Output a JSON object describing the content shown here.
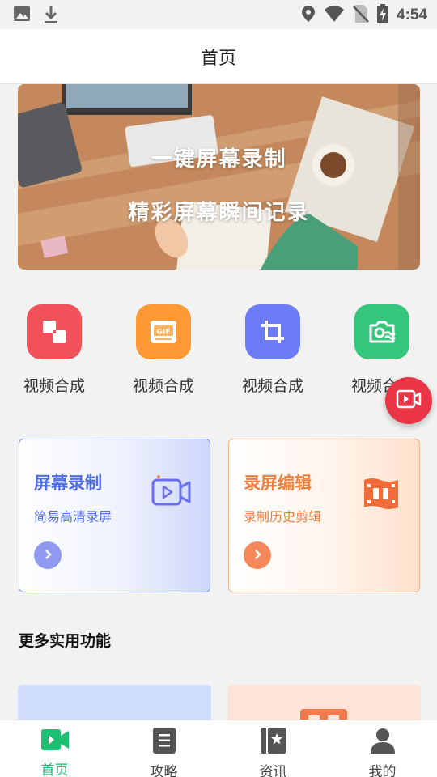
{
  "status_bar": {
    "time": "4:54"
  },
  "app_bar": {
    "title": "首页"
  },
  "banner": {
    "line1": "一键屏幕录制",
    "line2": "精彩屏幕瞬间记录"
  },
  "tools": [
    {
      "label": "视频合成",
      "color": "#f2515a",
      "icon": "split-squares-icon"
    },
    {
      "label": "视频合成",
      "color": "#ff9933",
      "icon": "gif-icon"
    },
    {
      "label": "视频合成",
      "color": "#6b7cf6",
      "icon": "crop-icon"
    },
    {
      "label": "视频合成",
      "color": "#34c77b",
      "icon": "camera-wave-icon"
    }
  ],
  "cards": [
    {
      "title": "屏幕录制",
      "subtitle": "简易高清录屏",
      "accent": "#4f6de6"
    },
    {
      "title": "录屏编辑",
      "subtitle": "录制历史剪辑",
      "accent": "#f07d3c"
    }
  ],
  "more_section": {
    "title": "更多实用功能"
  },
  "bottom_nav": [
    {
      "label": "首页",
      "icon": "video-play-icon",
      "active": true
    },
    {
      "label": "攻略",
      "icon": "document-icon",
      "active": false
    },
    {
      "label": "资讯",
      "icon": "book-star-icon",
      "active": false
    },
    {
      "label": "我的",
      "icon": "person-icon",
      "active": false
    }
  ],
  "colors": {
    "active_green": "#1dbf73",
    "record_red": "#ea3546"
  }
}
